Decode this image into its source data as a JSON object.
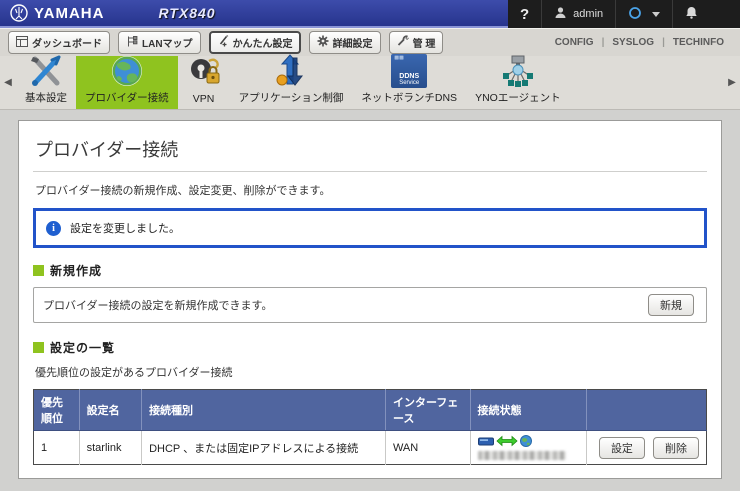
{
  "header": {
    "brand": "YAMAHA",
    "model": "RTX840",
    "help": "?",
    "user": "admin",
    "links": [
      "CONFIG",
      "SYSLOG",
      "TECHINFO"
    ]
  },
  "toolbar": {
    "tabs": [
      {
        "label": "ダッシュボード",
        "icon": "dashboard-icon"
      },
      {
        "label": "LANマップ",
        "icon": "lan-map-icon"
      },
      {
        "label": "かんたん設定",
        "icon": "easy-setup-wand-icon",
        "active": true
      },
      {
        "label": "詳細設定",
        "icon": "gear-icon"
      },
      {
        "label": "管 理",
        "icon": "wrench-icon"
      }
    ]
  },
  "icon_nav": {
    "items": [
      {
        "label": "基本設定",
        "icon": "tools-icon"
      },
      {
        "label": "プロバイダー接続",
        "icon": "globe-icon",
        "selected": true
      },
      {
        "label": "VPN",
        "icon": "keys-lock-icon"
      },
      {
        "label": "アプリケーション制御",
        "icon": "traffic-arrows-icon"
      },
      {
        "label": "ネットボランチDNS",
        "icon": "ddns-service-icon",
        "badge": [
          "DDNS",
          "Service"
        ]
      },
      {
        "label": "YNOエージェント",
        "icon": "network-agent-icon"
      }
    ]
  },
  "main": {
    "title": "プロバイダー接続",
    "description": "プロバイダー接続の新規作成、設定変更、削除ができます。",
    "notice": "設定を変更しました。",
    "create": {
      "heading": "新規作成",
      "text": "プロバイダー接続の設定を新規作成できます。",
      "button": "新規"
    },
    "list": {
      "heading": "設定の一覧",
      "subtext": "優先順位の設定があるプロバイダー接続",
      "table": {
        "headers": [
          "優先順位",
          "設定名",
          "接続種別",
          "インターフェース",
          "接続状態",
          ""
        ],
        "rows": [
          {
            "priority": "1",
            "name": "starlink",
            "type": "DHCP 、または固定IPアドレスによる接続",
            "interface": "WAN",
            "status_icons": [
              "router-icon",
              "link-active-arrow-icon",
              "internet-globe-icon"
            ],
            "status_detail": "redacted-address",
            "actions": [
              "設定",
              "削除"
            ]
          }
        ]
      }
    }
  },
  "colors": {
    "brand_blue": "#2c3a96",
    "accent_green": "#8fc31f",
    "notice_blue": "#2253c9",
    "table_header_blue": "#50659f"
  }
}
